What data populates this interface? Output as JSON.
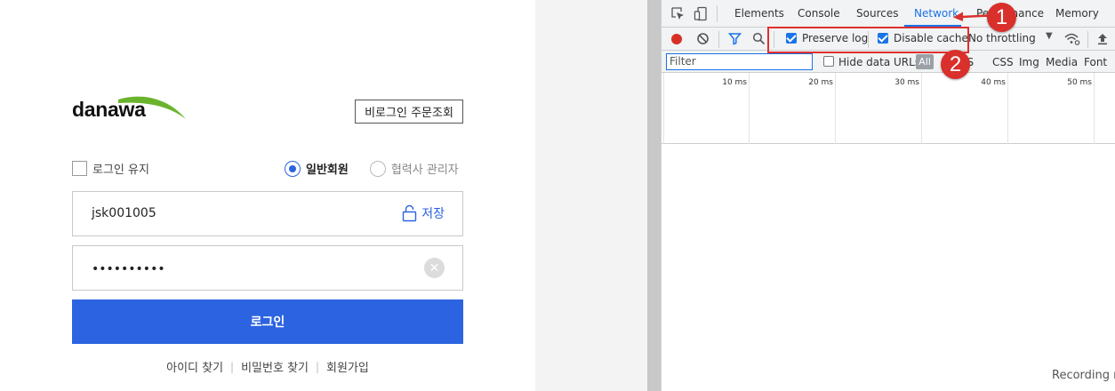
{
  "login": {
    "logo": "danawa",
    "guest_order_button": "비로그인 주문조회",
    "keep_login_label": "로그인 유지",
    "member_types": [
      {
        "label": "일반회원",
        "selected": true
      },
      {
        "label": "협력사 관리자",
        "selected": false
      }
    ],
    "user_id_value": "jsk001005",
    "save_id_label": "저장",
    "password_mask": "••••••••••",
    "clear_symbol": "✕",
    "login_button": "로그인",
    "links": [
      "아이디 찾기",
      "비밀번호 찾기",
      "회원가입"
    ],
    "link_separator": "|",
    "brand_color": "#2c63e0"
  },
  "devtools": {
    "tabs": [
      "Elements",
      "Console",
      "Sources",
      "Network",
      "Performance",
      "Memory"
    ],
    "active_tab": "Network",
    "toolbar": {
      "preserve_log": "Preserve log",
      "preserve_log_checked": true,
      "disable_cache": "Disable cache",
      "disable_cache_checked": true,
      "throttling": "No throttling"
    },
    "filter_placeholder": "Filter",
    "hide_data_urls": "Hide data URLs",
    "all_label": "All",
    "types": [
      "JS",
      "CSS",
      "Img",
      "Media",
      "Font"
    ],
    "timeline_ticks": [
      "10 ms",
      "20 ms",
      "30 ms",
      "40 ms",
      "50 ms"
    ],
    "footer_text": "Recording n",
    "accent_color": "#1a73e8"
  },
  "annotations": {
    "badges": [
      "1",
      "2"
    ],
    "color": "#d9302b"
  }
}
